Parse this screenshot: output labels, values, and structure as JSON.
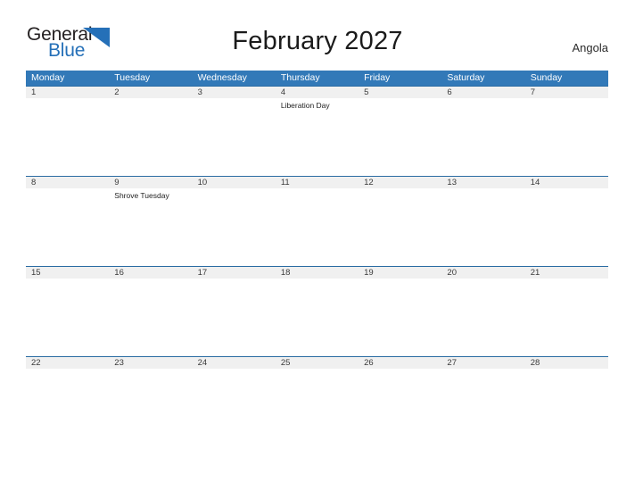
{
  "brand": {
    "word_one": "General",
    "word_two": "Blue",
    "flag_icon": "blue-triangle-flag-icon",
    "color_dark": "#231f20",
    "color_blue": "#2570b8"
  },
  "header": {
    "title": "February 2027",
    "country": "Angola"
  },
  "theme": {
    "header_blue": "#3279b8",
    "row_line_blue": "#2b6ca3",
    "day_band_gray": "#f0f0f0",
    "page_background": "#ffffff"
  },
  "calendar": {
    "weekdays": [
      "Monday",
      "Tuesday",
      "Wednesday",
      "Thursday",
      "Friday",
      "Saturday",
      "Sunday"
    ],
    "weeks": [
      [
        {
          "date": "1",
          "event": ""
        },
        {
          "date": "2",
          "event": ""
        },
        {
          "date": "3",
          "event": ""
        },
        {
          "date": "4",
          "event": "Liberation Day"
        },
        {
          "date": "5",
          "event": ""
        },
        {
          "date": "6",
          "event": ""
        },
        {
          "date": "7",
          "event": ""
        }
      ],
      [
        {
          "date": "8",
          "event": ""
        },
        {
          "date": "9",
          "event": "Shrove Tuesday"
        },
        {
          "date": "10",
          "event": ""
        },
        {
          "date": "11",
          "event": ""
        },
        {
          "date": "12",
          "event": ""
        },
        {
          "date": "13",
          "event": ""
        },
        {
          "date": "14",
          "event": ""
        }
      ],
      [
        {
          "date": "15",
          "event": ""
        },
        {
          "date": "16",
          "event": ""
        },
        {
          "date": "17",
          "event": ""
        },
        {
          "date": "18",
          "event": ""
        },
        {
          "date": "19",
          "event": ""
        },
        {
          "date": "20",
          "event": ""
        },
        {
          "date": "21",
          "event": ""
        }
      ],
      [
        {
          "date": "22",
          "event": ""
        },
        {
          "date": "23",
          "event": ""
        },
        {
          "date": "24",
          "event": ""
        },
        {
          "date": "25",
          "event": ""
        },
        {
          "date": "26",
          "event": ""
        },
        {
          "date": "27",
          "event": ""
        },
        {
          "date": "28",
          "event": ""
        }
      ]
    ]
  }
}
